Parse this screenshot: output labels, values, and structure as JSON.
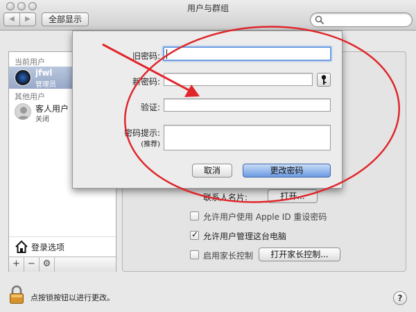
{
  "window": {
    "title": "用户与群组",
    "show_all": "全部显示",
    "nav_back": "◀",
    "nav_forward": "▶"
  },
  "sidebar": {
    "current_header": "当前用户",
    "current_user": {
      "name": "jfwl",
      "role": "管理员"
    },
    "other_header": "其他用户",
    "guest_user": {
      "name": "客人用户",
      "status": "关闭"
    },
    "login_options": "登录选项",
    "tools": {
      "add": "+",
      "remove": "−",
      "action": "⚙"
    }
  },
  "panel": {
    "contact_card_label": "联系人名片:",
    "open_button": "打开...",
    "apple_id_reset": "允许用户使用 Apple ID 重设密码",
    "admin_allow": "允许用户管理这台电脑",
    "parental_enable": "启用家长控制",
    "parental_open_button": "打开家长控制...",
    "apple_id_checked": false,
    "admin_checked": true,
    "parental_checked": false
  },
  "sheet": {
    "old_password_label": "旧密码:",
    "new_password_label": "新密码:",
    "verify_label": "验证:",
    "hint_label": "密码提示:",
    "hint_sub": "(推荐)",
    "cancel_button": "取消",
    "change_button": "更改密码",
    "old_password_value": "",
    "new_password_value": "",
    "verify_value": "",
    "hint_value": ""
  },
  "bottom": {
    "lock_text": "点按锁按钮以进行更改。",
    "help": "?"
  },
  "colors": {
    "annotation_red": "#e0262b",
    "selection": "#9fb0cf",
    "default_button": "#6b9be3"
  }
}
